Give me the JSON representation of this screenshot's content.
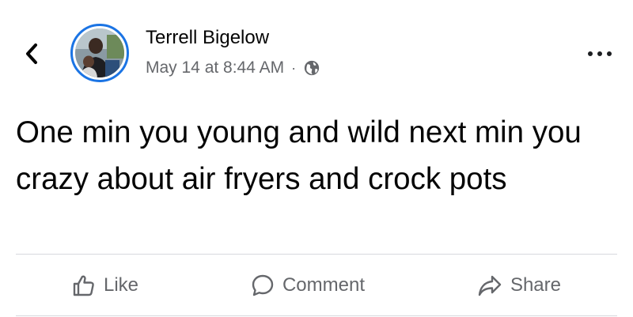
{
  "post": {
    "author_name": "Terrell Bigelow",
    "timestamp": "May 14 at 8:44 AM",
    "separator": "·",
    "audience_icon": "globe-icon",
    "text": "One min you young and wild next min you crazy about air fryers and crock pots"
  },
  "actions": {
    "like_label": "Like",
    "comment_label": "Comment",
    "share_label": "Share"
  },
  "icons": {
    "back": "chevron-left-icon",
    "more": "more-horizontal-icon",
    "like": "thumbs-up-icon",
    "comment": "comment-bubble-icon",
    "share": "share-arrow-icon"
  },
  "colors": {
    "text_primary": "#050505",
    "text_secondary": "#65676b",
    "avatar_ring": "#1b74e4",
    "divider": "#d7d9dd"
  }
}
